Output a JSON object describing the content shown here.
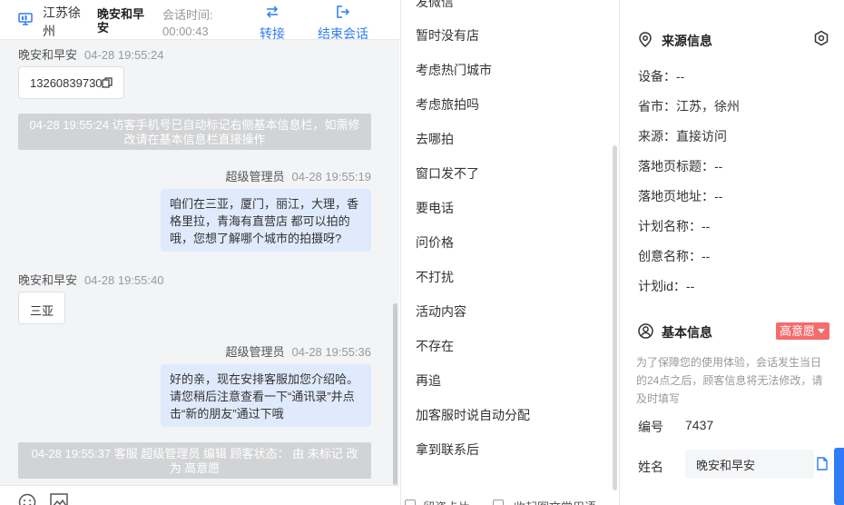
{
  "header": {
    "location": "江苏徐州",
    "visitor_name": "晚安和早安",
    "session_time_label": "会话时间:",
    "session_time_value": "00:00:43",
    "transfer_label": "转接",
    "end_label": "结束会话"
  },
  "messages": {
    "m1": {
      "who": "晚安和早安",
      "time": "04-28 19:55:24",
      "text": "13260839730"
    },
    "sys1": "04-28 19:55:24 访客手机号已自动标记右侧基本信息栏，如需修改请在基本信息栏直接操作",
    "m2": {
      "who": "超级管理员",
      "time": "04-28 19:55:19",
      "text": "咱们在三亚，厦门，丽江，大理，香格里拉，青海有直营店 都可以拍的哦，您想了解哪个城市的拍摄呀?"
    },
    "m3": {
      "who": "晚安和早安",
      "time": "04-28 19:55:40",
      "text": "三亚"
    },
    "m4": {
      "who": "超级管理员",
      "time": "04-28 19:55:36",
      "text": "好的亲，现在安排客服加您介绍哈。请您稍后注意查看一下“通讯录”并点击“新的朋友”通过下哦"
    },
    "sys2": "04-28 19:55:37 客服 超级管理员 编辑 顾客状态： 由 未标记 改为 高意愿"
  },
  "quick_replies": [
    "发微信",
    "暂时没有店",
    "考虑热门城市",
    "考虑旅拍吗",
    "去哪拍",
    "窗口发不了",
    "要电话",
    "问价格",
    "不打扰",
    "活动内容",
    "不存在",
    "再追",
    "加客服时说自动分配",
    "拿到联系后"
  ],
  "replies_footer": {
    "opt1": "留资卡片",
    "opt2": "收起图文常用语"
  },
  "source_info": {
    "title": "来源信息",
    "rows": [
      {
        "k": "设备",
        "v": "--"
      },
      {
        "k": "省市",
        "v": "江苏，徐州"
      },
      {
        "k": "来源",
        "v": "直接访问"
      },
      {
        "k": "落地页标题",
        "v": "--"
      },
      {
        "k": "落地页地址",
        "v": "--"
      },
      {
        "k": "计划名称",
        "v": "--"
      },
      {
        "k": "创意名称",
        "v": "--"
      },
      {
        "k": "计划id",
        "v": "--"
      }
    ]
  },
  "basic_info": {
    "title": "基本信息",
    "intent_badge": "高意愿",
    "note": "为了保障您的使用体验，会话发生当日的24点之后，顾客信息将无法修改，请及时填写",
    "id_label": "编号",
    "id_value": "7437",
    "name_label": "姓名",
    "name_value": "晚安和早安"
  },
  "colors": {
    "accent": "#2f7cf6",
    "bubble_agent": "#dfeafc",
    "badge": "#f56c6c",
    "system_note": "#d2d3d5"
  }
}
